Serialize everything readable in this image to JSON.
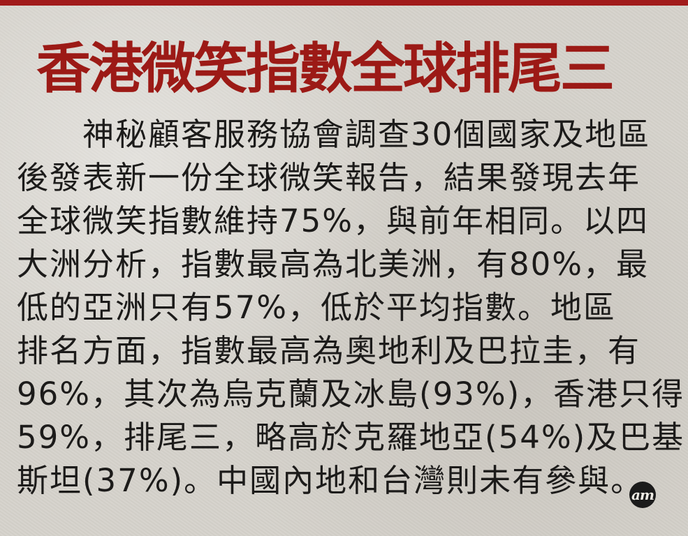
{
  "article": {
    "headline": "香港微笑指數全球排尾三",
    "body_lines": [
      "神秘顧客服務協會調查30個國家及地區",
      "後發表新一份全球微笑報告，結果發現去年",
      "全球微笑指數維持75%，與前年相同。以四",
      "大洲分析，指數最高為北美洲，有80%，最",
      "低的亞洲只有57%，低於平均指數。地區",
      "排名方面，指數最高為奧地利及巴拉圭，有",
      "96%，其次為烏克蘭及冰島(93%)，香港只得",
      "59%，排尾三，略高於克羅地亞(54%)及巴基",
      "斯坦(37%)。中國內地和台灣則未有參與。"
    ],
    "end_mark": "am"
  },
  "colors": {
    "headline": "#9c1a16",
    "body_text": "#1c1b1a",
    "paper": "#d6d3cc",
    "top_rule": "#a11b1b"
  }
}
